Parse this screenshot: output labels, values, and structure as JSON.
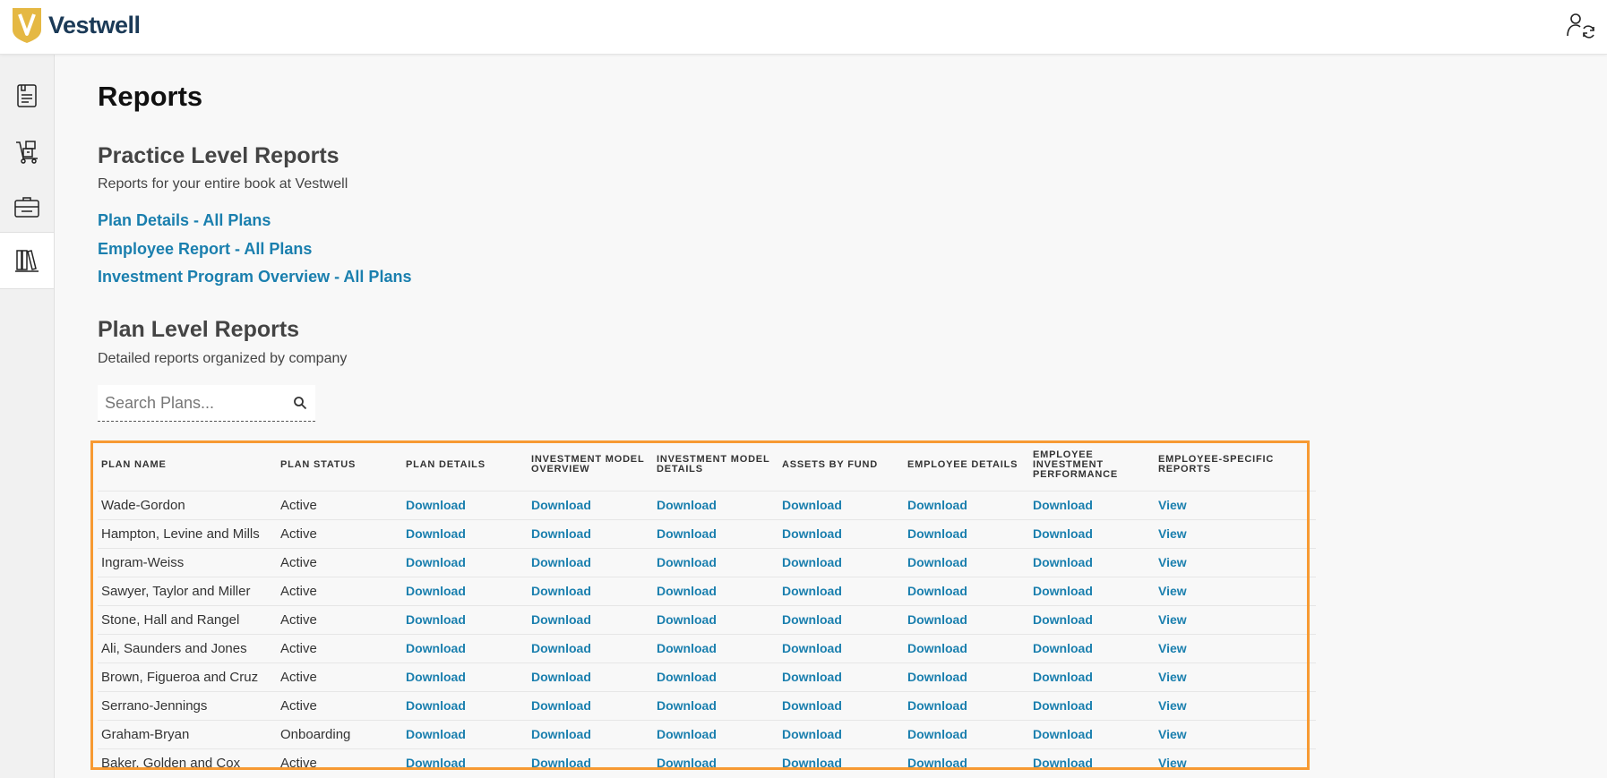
{
  "app": {
    "brand": "Vestwell",
    "brand_initial": "V",
    "colors": {
      "brand_navy": "#1b3a57",
      "brand_gold": "#e5b843",
      "link_blue": "#1a7fae",
      "highlight_orange": "#f79a33"
    }
  },
  "topbar": {
    "user_switch_icon": "user-switch-icon"
  },
  "sidebar": {
    "items": [
      {
        "icon": "document-list-icon"
      },
      {
        "icon": "hand-truck-icon"
      },
      {
        "icon": "briefcase-icon"
      },
      {
        "icon": "books-icon",
        "active": true
      }
    ]
  },
  "page": {
    "title": "Reports"
  },
  "practice": {
    "title": "Practice Level Reports",
    "description": "Reports for your entire book at Vestwell",
    "links": [
      "Plan Details - All Plans",
      "Employee Report - All Plans",
      "Investment Program Overview - All Plans"
    ]
  },
  "plan_level": {
    "title": "Plan Level Reports",
    "description": "Detailed reports organized by company",
    "search": {
      "placeholder": "Search Plans..."
    }
  },
  "table": {
    "columns": [
      "PLAN NAME",
      "PLAN STATUS",
      "PLAN DETAILS",
      "INVESTMENT MODEL OVERVIEW",
      "INVESTMENT MODEL DETAILS",
      "ASSETS BY FUND",
      "EMPLOYEE DETAILS",
      "EMPLOYEE INVESTMENT PERFORMANCE",
      "EMPLOYEE-SPECIFIC REPORTS"
    ],
    "download_label": "Download",
    "view_label": "View",
    "rows": [
      {
        "name": "Wade-Gordon",
        "status": "Active"
      },
      {
        "name": "Hampton, Levine and Mills",
        "status": "Active"
      },
      {
        "name": "Ingram-Weiss",
        "status": "Active"
      },
      {
        "name": "Sawyer, Taylor and Miller",
        "status": "Active"
      },
      {
        "name": "Stone, Hall and Rangel",
        "status": "Active"
      },
      {
        "name": "Ali, Saunders and Jones",
        "status": "Active"
      },
      {
        "name": "Brown, Figueroa and Cruz",
        "status": "Active"
      },
      {
        "name": "Serrano-Jennings",
        "status": "Active"
      },
      {
        "name": "Graham-Bryan",
        "status": "Onboarding"
      },
      {
        "name": "Baker, Golden and Cox",
        "status": "Active"
      }
    ]
  }
}
